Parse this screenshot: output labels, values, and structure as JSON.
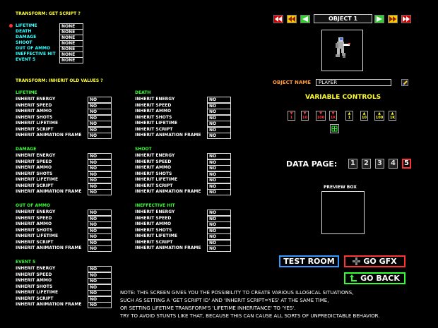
{
  "transform": {
    "title": "TRANSFORM: GET SCRIPT ?",
    "items": [
      {
        "label": "LIFETIME",
        "value": "NONE",
        "selected": true
      },
      {
        "label": "DEATH",
        "value": "NONE"
      },
      {
        "label": "DAMAGE",
        "value": "NONE"
      },
      {
        "label": "SHOOT",
        "value": "NONE"
      },
      {
        "label": "OUT OF AMMO",
        "value": "NONE"
      },
      {
        "label": "INEFFECTIVE HIT",
        "value": "NONE"
      },
      {
        "label": "EVENT 5",
        "value": "NONE"
      }
    ]
  },
  "inherit": {
    "title": "TRANSFORM: INHERIT OLD VALUES ?",
    "row_labels": [
      "INHERIT ENERGY",
      "INHERIT SPEED",
      "INHERIT AMMO",
      "INHERIT SHOTS",
      "INHERIT LIFETIME",
      "INHERIT SCRIPT",
      "INHERIT ANIMATION FRAME"
    ],
    "groups": [
      {
        "title": "LIFETIME",
        "values": [
          "NO",
          "NO",
          "NO",
          "NO",
          "NO",
          "NO",
          "NO"
        ]
      },
      {
        "title": "DEATH",
        "values": [
          "NO",
          "NO",
          "NO",
          "NO",
          "NO",
          "NO",
          "NO"
        ]
      },
      {
        "title": "DAMAGE",
        "values": [
          "NO",
          "NO",
          "NO",
          "NO",
          "NO",
          "NO",
          "NO"
        ]
      },
      {
        "title": "SHOOT",
        "values": [
          "NO",
          "NO",
          "NO",
          "NO",
          "NO",
          "NO",
          "NO"
        ]
      },
      {
        "title": "OUT OF AMMO",
        "values": [
          "NO",
          "NO",
          "NO",
          "NO",
          "NO",
          "NO",
          "NO"
        ]
      },
      {
        "title": "INEFFECTIVE HIT",
        "values": [
          "NO",
          "NO",
          "NO",
          "NO",
          "NO",
          "NO",
          "NO"
        ]
      },
      {
        "title": "EVENT 5",
        "values": [
          "NO",
          "NO",
          "NO",
          "NO",
          "NO",
          "NO",
          "NO"
        ]
      }
    ]
  },
  "object": {
    "selector_label": "OBJECT 1",
    "name_label": "OBJECT NAME",
    "name_value": "PLAYER"
  },
  "variable_controls": {
    "title": "VARIABLE CONTROLS",
    "buttons": [
      {
        "value": "1",
        "dir": "down"
      },
      {
        "value": "10",
        "dir": "down"
      },
      {
        "value": "100",
        "dir": "down"
      },
      {
        "value": "1K",
        "dir": "down"
      },
      {
        "value": "1",
        "dir": "up"
      },
      {
        "value": "10",
        "dir": "up"
      },
      {
        "value": "100",
        "dir": "up"
      },
      {
        "value": "1K",
        "dir": "up"
      }
    ]
  },
  "data_page": {
    "label": "DATA PAGE:",
    "pages": [
      "1",
      "2",
      "3",
      "4",
      "5"
    ],
    "active": "5"
  },
  "preview_box_label": "PREVIEW BOX",
  "buttons": {
    "test_room": "TEST ROOM",
    "go_gfx": "GO GFX",
    "go_back": "GO BACK"
  },
  "note_lines": [
    "NOTE: THIS SCREEN GIVES YOU THE POSSIBILITY TO CREATE VARIOUS ILLOGICAL SITUATIONS,",
    "SUCH AS SETTING A 'GET SCRIPT ID' AND 'INHERIT SCRIPT=YES' AT THE SAME TIME,",
    "OR SETTING LIFETIME TRANSFORM'S 'LIFETIME INHERITANCE' TO 'YES'.",
    "TRY TO AVOID STUNTS LIKE THAT, BECAUSE THIS CAN CAUSE ALL SORTS OF UNPREDICTABLE BEHAVIOR."
  ],
  "colors": {
    "title_yellow": "#ffff33",
    "group_green": "#33ff33",
    "cyan": "#33ffff",
    "orange": "#ff9933",
    "red": "#ff2222"
  }
}
